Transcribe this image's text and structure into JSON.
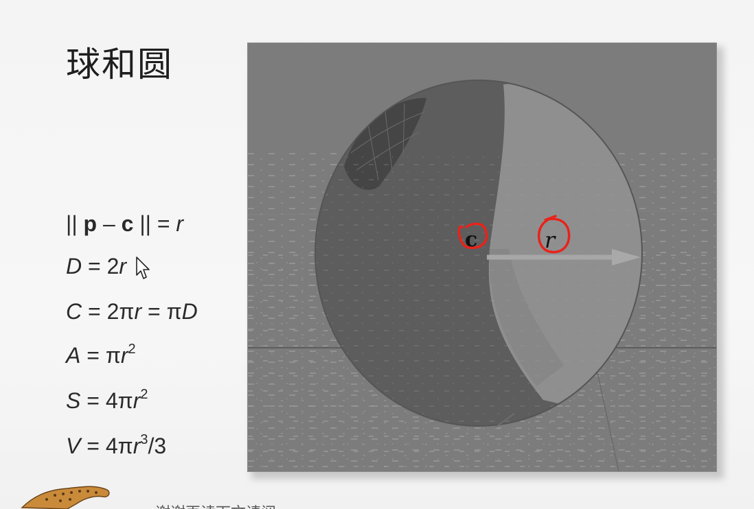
{
  "slide": {
    "title": "球和圆",
    "formulas": [
      {
        "lhs_norm_open": "|| ",
        "p": "p",
        "minus": " – ",
        "c": "c",
        "norm_close": " || = ",
        "r": "r"
      },
      {
        "lhs": "D",
        "rhs_plain": " = 2",
        "rhs_var": "r"
      },
      {
        "lhs": "C",
        "rhs_plain": " = 2π",
        "rhs_var": "r",
        "rhs_tail": " = π",
        "rhs_var2": "D"
      },
      {
        "lhs": "A",
        "rhs_plain": " = π",
        "rhs_var": "r",
        "sup": "2"
      },
      {
        "lhs": "S",
        "rhs_plain": " = 4π",
        "rhs_var": "r",
        "sup": "2"
      },
      {
        "lhs": "V",
        "rhs_plain": " = 4π",
        "rhs_var": "r",
        "sup": "3",
        "tail": "/3"
      }
    ],
    "figure_labels": {
      "center": "c",
      "radius": "r"
    },
    "footer_text": "谢谢再读下文请阅",
    "colors": {
      "annotation": "#e8231a",
      "sphere_dark": "#5a5a5a",
      "sphere_light": "#8e8e8e",
      "background": "#7c7c7c"
    }
  }
}
